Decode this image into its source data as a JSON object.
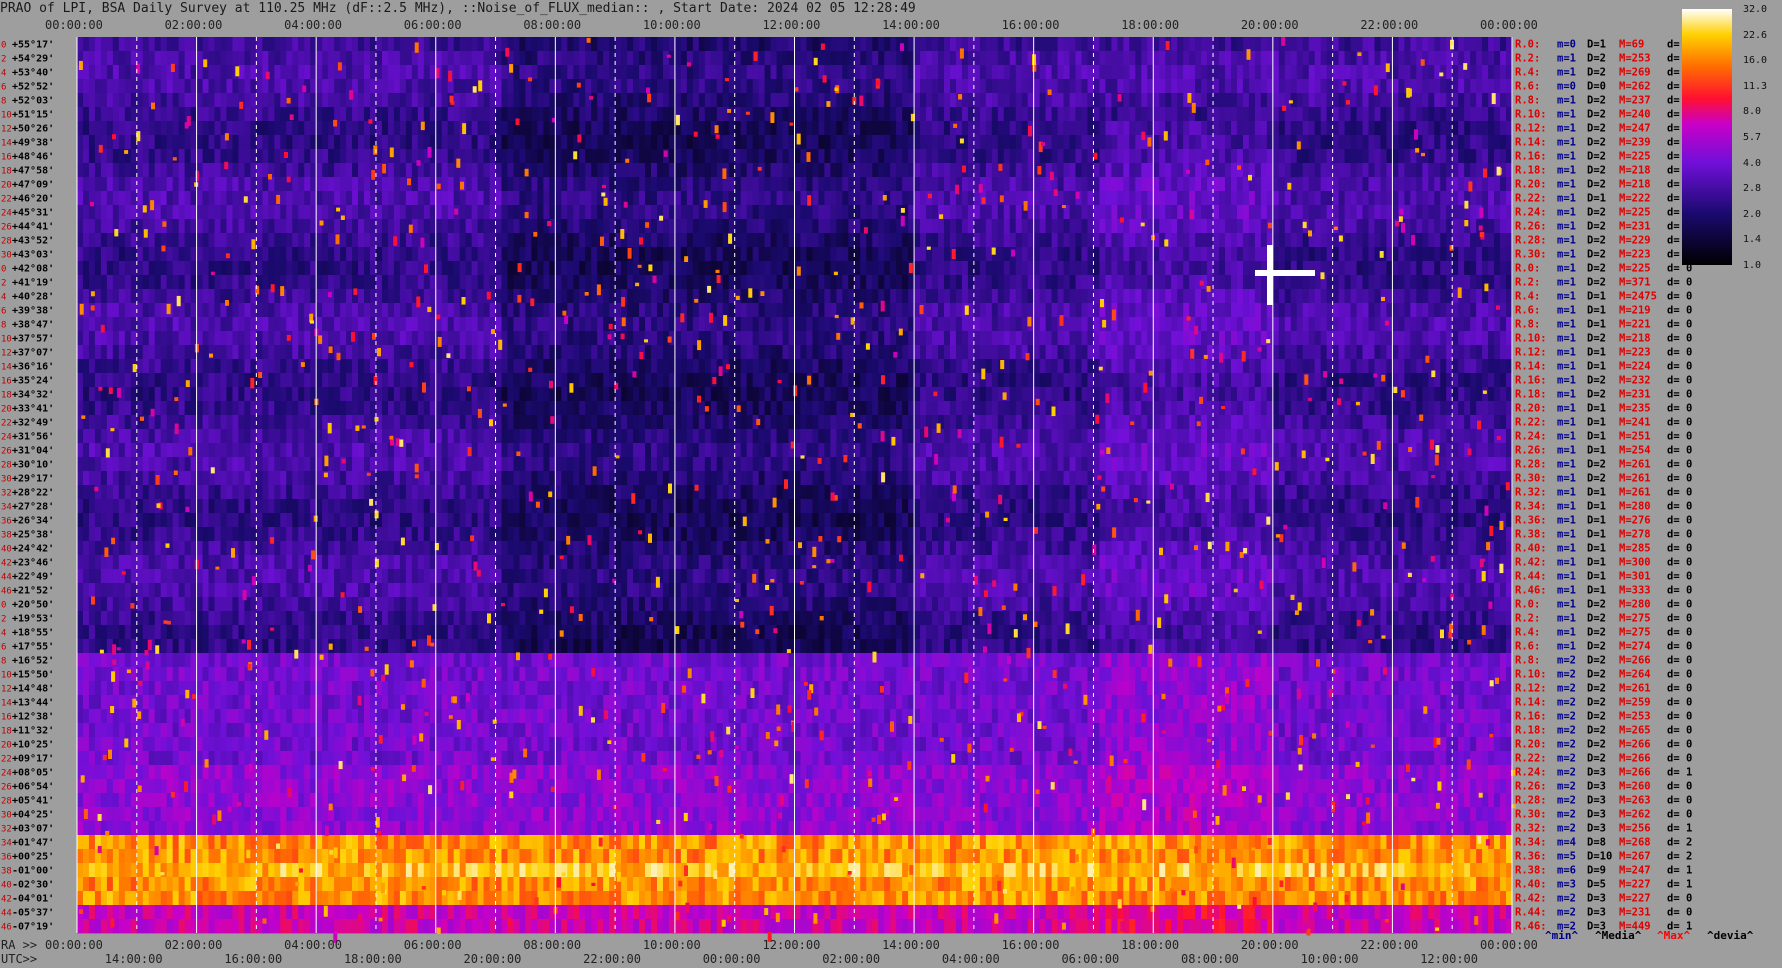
{
  "chart_data": {
    "type": "heatmap",
    "title": "PRAO of LPI, BSA Daily Survey at 110.25 MHz (dF::2.5 MHz), ::Noise_of_FLUX_median:: , Start Date: 2024 02 05 12:28:49",
    "top_axis_ticks": [
      "00:00:00",
      "02:00:00",
      "04:00:00",
      "06:00:00",
      "08:00:00",
      "10:00:00",
      "12:00:00",
      "14:00:00",
      "16:00:00",
      "18:00:00",
      "20:00:00",
      "22:00:00",
      "00:00:00"
    ],
    "ra_axis_label": "RA >>",
    "ra_axis_ticks": [
      "00:00:00",
      "02:00:00",
      "04:00:00",
      "06:00:00",
      "08:00:00",
      "10:00:00",
      "12:00:00",
      "14:00:00",
      "16:00:00",
      "18:00:00",
      "20:00:00",
      "22:00:00",
      "00:00:00"
    ],
    "utc_axis_label": "UTC>>",
    "utc_axis_ticks": [
      "14:00:00",
      "16:00:00",
      "18:00:00",
      "20:00:00",
      "22:00:00",
      "00:00:00",
      "02:00:00",
      "04:00:00",
      "06:00:00",
      "08:00:00",
      "10:00:00",
      "12:00:00"
    ],
    "declination_labels": [
      "+55°17'",
      "+54°29'",
      "+53°40'",
      "+52°52'",
      "+52°03'",
      "+51°15'",
      "+50°26'",
      "+49°38'",
      "+48°46'",
      "+47°58'",
      "+47°09'",
      "+46°20'",
      "+45°31'",
      "+44°41'",
      "+43°52'",
      "+43°03'",
      "+42°08'",
      "+41°19'",
      "+40°28'",
      "+39°38'",
      "+38°47'",
      "+37°57'",
      "+37°07'",
      "+36°16'",
      "+35°24'",
      "+34°32'",
      "+33°41'",
      "+32°49'",
      "+31°56'",
      "+31°04'",
      "+30°10'",
      "+29°17'",
      "+28°22'",
      "+27°28'",
      "+26°34'",
      "+25°38'",
      "+24°42'",
      "+23°46'",
      "+22°49'",
      "+21°52'",
      "+20°50'",
      "+19°53'",
      "+18°55'",
      "+17°55'",
      "+16°52'",
      "+15°50'",
      "+14°48'",
      "+13°44'",
      "+12°38'",
      "+11°32'",
      "+10°25'",
      "+09°17'",
      "+08°05'",
      "+06°54'",
      "+05°41'",
      "+04°25'",
      "+03°07'",
      "+01°47'",
      "+00°25'",
      "-01°00'",
      "-02°30'",
      "-04°01'",
      "-05°37'",
      "-07°19'"
    ],
    "row_indices": [
      "0",
      "2",
      "4",
      "6",
      "8",
      "10",
      "12",
      "14",
      "16",
      "18",
      "20",
      "22",
      "24",
      "26",
      "28",
      "30",
      "0",
      "2",
      "4",
      "6",
      "8",
      "10",
      "12",
      "14",
      "16",
      "18",
      "20",
      "22",
      "24",
      "26",
      "28",
      "30",
      "32",
      "34",
      "36",
      "38",
      "40",
      "42",
      "44",
      "46",
      "0",
      "2",
      "4",
      "6",
      "8",
      "10",
      "12",
      "14",
      "16",
      "18",
      "20",
      "22",
      "24",
      "26",
      "28",
      "30",
      "32",
      "34",
      "36",
      "38",
      "40",
      "42",
      "44",
      "46"
    ],
    "row_stats": [
      {
        "r": "R.0:",
        "m": "m=0",
        "D": "D=1",
        "M": "M=69",
        "d": "d= 0"
      },
      {
        "r": "R.2:",
        "m": "m=1",
        "D": "D=2",
        "M": "M=253",
        "d": "d= 0"
      },
      {
        "r": "R.4:",
        "m": "m=1",
        "D": "D=2",
        "M": "M=269",
        "d": "d= 0"
      },
      {
        "r": "R.6:",
        "m": "m=0",
        "D": "D=0",
        "M": "M=262",
        "d": "d= 1"
      },
      {
        "r": "R.8:",
        "m": "m=1",
        "D": "D=2",
        "M": "M=237",
        "d": "d= 0"
      },
      {
        "r": "R.10:",
        "m": "m=1",
        "D": "D=2",
        "M": "M=240",
        "d": "d="
      },
      {
        "r": "R.12:",
        "m": "m=1",
        "D": "D=2",
        "M": "M=247",
        "d": "d="
      },
      {
        "r": "R.14:",
        "m": "m=1",
        "D": "D=2",
        "M": "M=239",
        "d": "d="
      },
      {
        "r": "R.16:",
        "m": "m=1",
        "D": "D=2",
        "M": "M=225",
        "d": "d="
      },
      {
        "r": "R.18:",
        "m": "m=1",
        "D": "D=2",
        "M": "M=218",
        "d": "d="
      },
      {
        "r": "R.20:",
        "m": "m=1",
        "D": "D=2",
        "M": "M=218",
        "d": "d="
      },
      {
        "r": "R.22:",
        "m": "m=1",
        "D": "D=1",
        "M": "M=222",
        "d": "d="
      },
      {
        "r": "R.24:",
        "m": "m=1",
        "D": "D=2",
        "M": "M=225",
        "d": "d="
      },
      {
        "r": "R.26:",
        "m": "m=1",
        "D": "D=2",
        "M": "M=231",
        "d": "d="
      },
      {
        "r": "R.28:",
        "m": "m=1",
        "D": "D=2",
        "M": "M=229",
        "d": "d="
      },
      {
        "r": "R.30:",
        "m": "m=1",
        "D": "D=2",
        "M": "M=223",
        "d": "d="
      },
      {
        "r": "R.0:",
        "m": "m=1",
        "D": "D=2",
        "M": "M=225",
        "d": "d= 0"
      },
      {
        "r": "R.2:",
        "m": "m=1",
        "D": "D=2",
        "M": "M=371",
        "d": "d= 0"
      },
      {
        "r": "R.4:",
        "m": "m=1",
        "D": "D=1",
        "M": "M=2475",
        "d": "d= 0"
      },
      {
        "r": "R.6:",
        "m": "m=1",
        "D": "D=1",
        "M": "M=219",
        "d": "d= 0"
      },
      {
        "r": "R.8:",
        "m": "m=1",
        "D": "D=1",
        "M": "M=221",
        "d": "d= 0"
      },
      {
        "r": "R.10:",
        "m": "m=1",
        "D": "D=2",
        "M": "M=218",
        "d": "d= 0"
      },
      {
        "r": "R.12:",
        "m": "m=1",
        "D": "D=1",
        "M": "M=223",
        "d": "d= 0"
      },
      {
        "r": "R.14:",
        "m": "m=1",
        "D": "D=1",
        "M": "M=224",
        "d": "d= 0"
      },
      {
        "r": "R.16:",
        "m": "m=1",
        "D": "D=2",
        "M": "M=232",
        "d": "d= 0"
      },
      {
        "r": "R.18:",
        "m": "m=1",
        "D": "D=2",
        "M": "M=231",
        "d": "d= 0"
      },
      {
        "r": "R.20:",
        "m": "m=1",
        "D": "D=1",
        "M": "M=235",
        "d": "d= 0"
      },
      {
        "r": "R.22:",
        "m": "m=1",
        "D": "D=1",
        "M": "M=241",
        "d": "d= 0"
      },
      {
        "r": "R.24:",
        "m": "m=1",
        "D": "D=1",
        "M": "M=251",
        "d": "d= 0"
      },
      {
        "r": "R.26:",
        "m": "m=1",
        "D": "D=1",
        "M": "M=254",
        "d": "d= 0"
      },
      {
        "r": "R.28:",
        "m": "m=1",
        "D": "D=2",
        "M": "M=261",
        "d": "d= 0"
      },
      {
        "r": "R.30:",
        "m": "m=1",
        "D": "D=2",
        "M": "M=261",
        "d": "d= 0"
      },
      {
        "r": "R.32:",
        "m": "m=1",
        "D": "D=1",
        "M": "M=261",
        "d": "d= 0"
      },
      {
        "r": "R.34:",
        "m": "m=1",
        "D": "D=1",
        "M": "M=280",
        "d": "d= 0"
      },
      {
        "r": "R.36:",
        "m": "m=1",
        "D": "D=1",
        "M": "M=276",
        "d": "d= 0"
      },
      {
        "r": "R.38:",
        "m": "m=1",
        "D": "D=1",
        "M": "M=278",
        "d": "d= 0"
      },
      {
        "r": "R.40:",
        "m": "m=1",
        "D": "D=1",
        "M": "M=285",
        "d": "d= 0"
      },
      {
        "r": "R.42:",
        "m": "m=1",
        "D": "D=1",
        "M": "M=300",
        "d": "d= 0"
      },
      {
        "r": "R.44:",
        "m": "m=1",
        "D": "D=1",
        "M": "M=301",
        "d": "d= 0"
      },
      {
        "r": "R.46:",
        "m": "m=1",
        "D": "D=1",
        "M": "M=333",
        "d": "d= 0"
      },
      {
        "r": "R.0:",
        "m": "m=1",
        "D": "D=2",
        "M": "M=280",
        "d": "d= 0"
      },
      {
        "r": "R.2:",
        "m": "m=1",
        "D": "D=2",
        "M": "M=275",
        "d": "d= 0"
      },
      {
        "r": "R.4:",
        "m": "m=1",
        "D": "D=2",
        "M": "M=275",
        "d": "d= 0"
      },
      {
        "r": "R.6:",
        "m": "m=1",
        "D": "D=2",
        "M": "M=274",
        "d": "d= 0"
      },
      {
        "r": "R.8:",
        "m": "m=2",
        "D": "D=2",
        "M": "M=266",
        "d": "d= 0"
      },
      {
        "r": "R.10:",
        "m": "m=2",
        "D": "D=2",
        "M": "M=264",
        "d": "d= 0"
      },
      {
        "r": "R.12:",
        "m": "m=2",
        "D": "D=2",
        "M": "M=261",
        "d": "d= 0"
      },
      {
        "r": "R.14:",
        "m": "m=2",
        "D": "D=2",
        "M": "M=259",
        "d": "d= 0"
      },
      {
        "r": "R.16:",
        "m": "m=2",
        "D": "D=2",
        "M": "M=253",
        "d": "d= 0"
      },
      {
        "r": "R.18:",
        "m": "m=2",
        "D": "D=2",
        "M": "M=265",
        "d": "d= 0"
      },
      {
        "r": "R.20:",
        "m": "m=2",
        "D": "D=2",
        "M": "M=266",
        "d": "d= 0"
      },
      {
        "r": "R.22:",
        "m": "m=2",
        "D": "D=2",
        "M": "M=266",
        "d": "d= 0"
      },
      {
        "r": "R.24:",
        "m": "m=2",
        "D": "D=3",
        "M": "M=266",
        "d": "d= 1"
      },
      {
        "r": "R.26:",
        "m": "m=2",
        "D": "D=3",
        "M": "M=260",
        "d": "d= 0"
      },
      {
        "r": "R.28:",
        "m": "m=2",
        "D": "D=3",
        "M": "M=263",
        "d": "d= 0"
      },
      {
        "r": "R.30:",
        "m": "m=2",
        "D": "D=3",
        "M": "M=262",
        "d": "d= 0"
      },
      {
        "r": "R.32:",
        "m": "m=2",
        "D": "D=3",
        "M": "M=256",
        "d": "d= 1"
      },
      {
        "r": "R.34:",
        "m": "m=4",
        "D": "D=8",
        "M": "M=268",
        "d": "d= 2"
      },
      {
        "r": "R.36:",
        "m": "m=5",
        "D": "D=10",
        "M": "M=267",
        "d": "d= 2"
      },
      {
        "r": "R.38:",
        "m": "m=6",
        "D": "D=9",
        "M": "M=247",
        "d": "d= 1"
      },
      {
        "r": "R.40:",
        "m": "m=3",
        "D": "D=5",
        "M": "M=227",
        "d": "d= 1"
      },
      {
        "r": "R.42:",
        "m": "m=2",
        "D": "D=3",
        "M": "M=227",
        "d": "d= 0"
      },
      {
        "r": "R.44:",
        "m": "m=2",
        "D": "D=3",
        "M": "M=231",
        "d": "d= 0"
      },
      {
        "r": "R.46:",
        "m": "m=2",
        "D": "D=3",
        "M": "M=449",
        "d": "d= 1"
      }
    ],
    "stats_legend": [
      "^min^",
      "^Media^",
      "^Max^",
      "^devia^"
    ],
    "colorbar_ticks": [
      "32.0",
      "22.6",
      "16.0",
      "11.3",
      "8.0",
      "5.7",
      "4.0",
      "2.8",
      "2.0",
      "1.4",
      "1.0"
    ],
    "colorbar_range": [
      1.0,
      32.0
    ],
    "colorbar_scale": "log",
    "colors": {
      "legend_min": "#00008b",
      "legend_media": "#000000",
      "legend_max": "#ff0000",
      "legend_devia": "#000000",
      "stat_red": "#e00000",
      "stat_blue": "#00008b",
      "stat_black": "#000000"
    }
  }
}
